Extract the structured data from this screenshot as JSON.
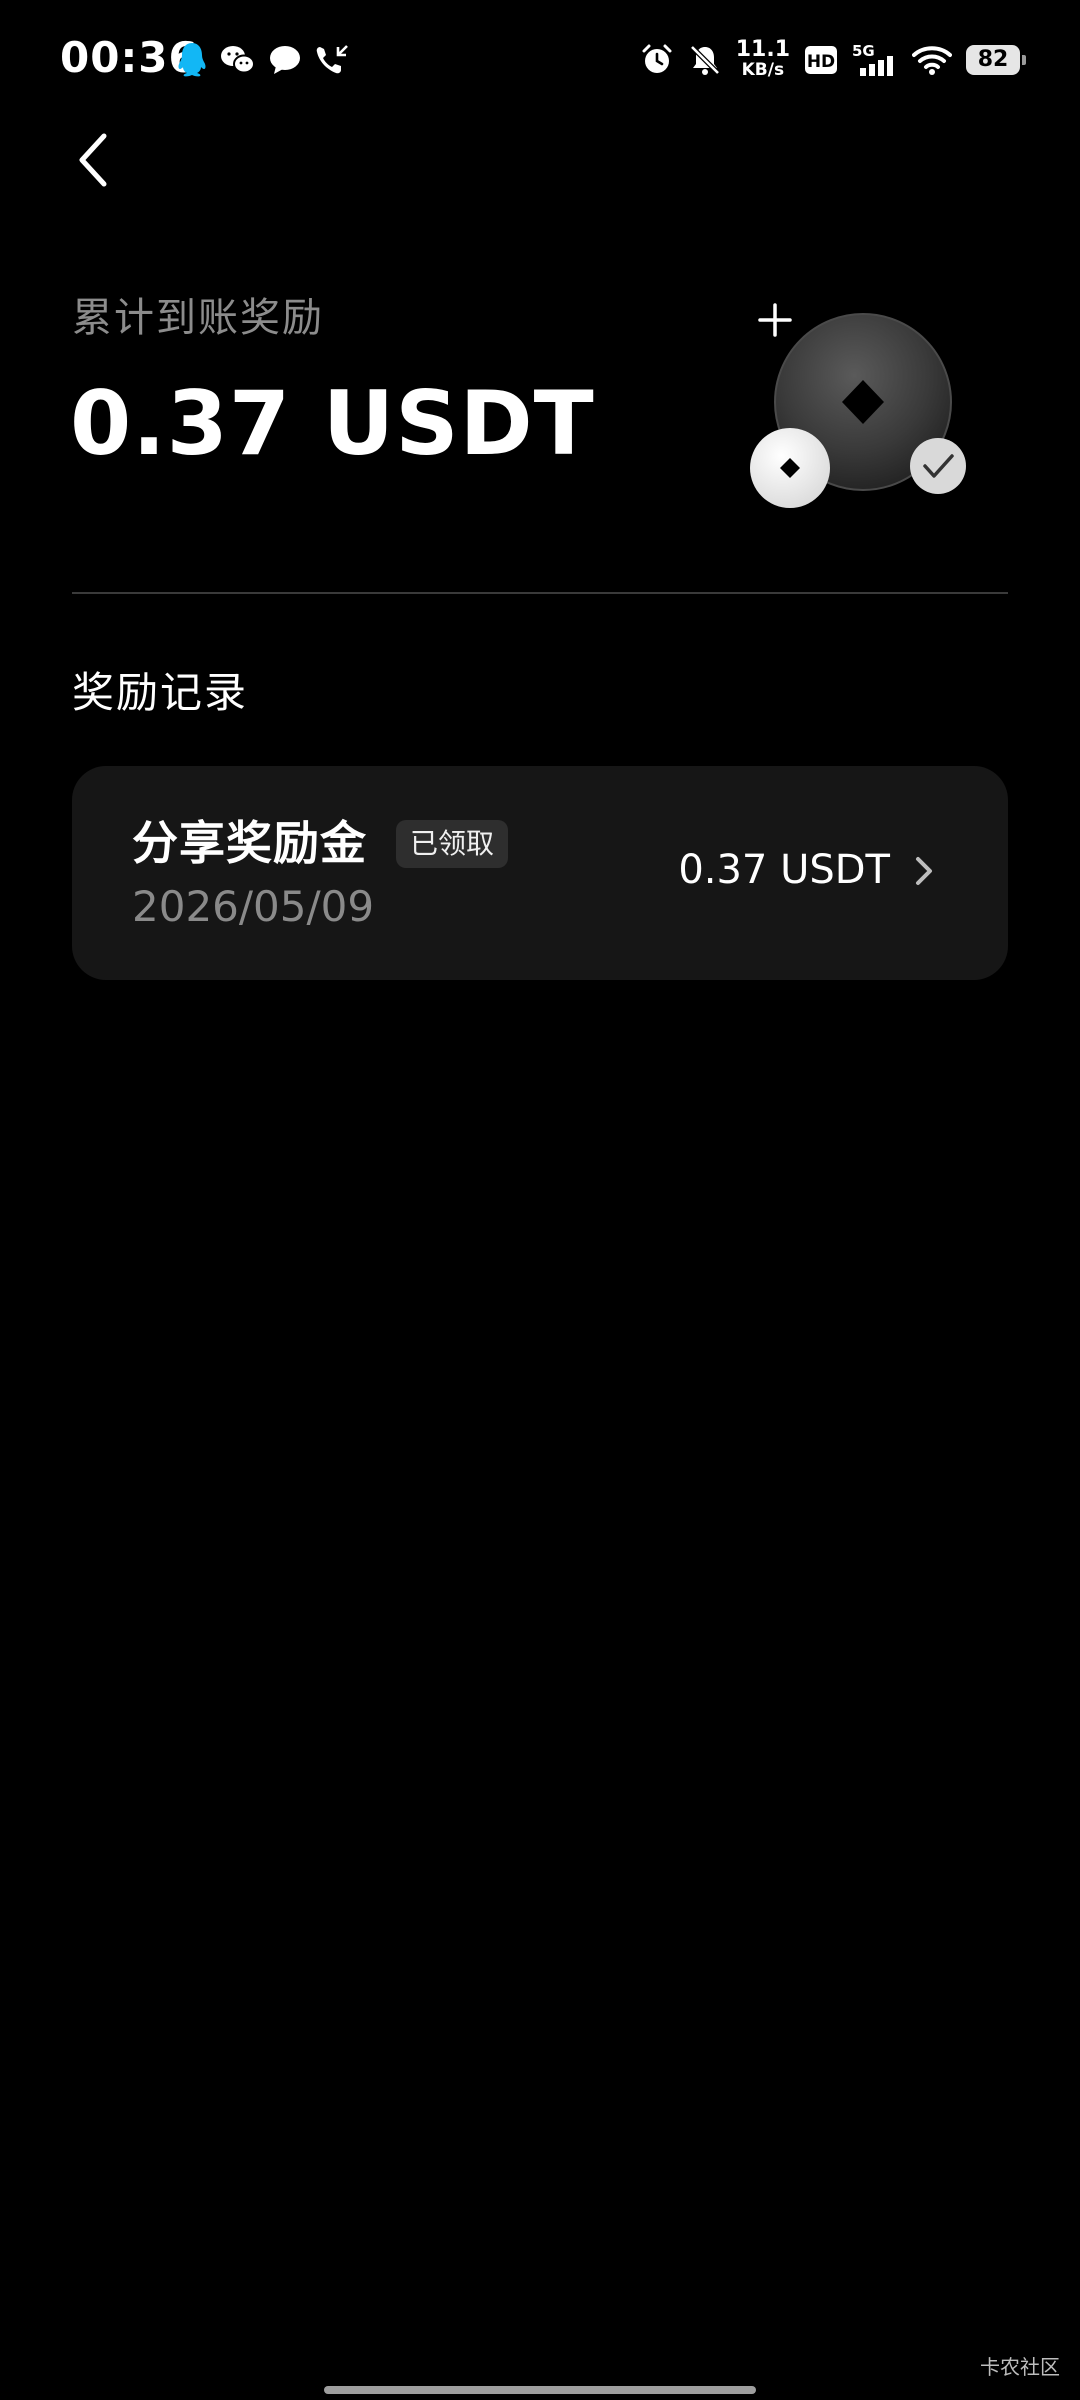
{
  "status_bar": {
    "time": "00:36",
    "app_icons": [
      "qq-icon",
      "wechat-icon",
      "message-icon",
      "missed-call-icon"
    ],
    "system_icons": [
      "alarm-icon",
      "mute-icon",
      "hd-icon",
      "signal-icon",
      "wifi-icon"
    ],
    "net_speed": "11.1",
    "net_speed_unit": "KB/s",
    "network_type": "5G",
    "hd_label": "HD",
    "battery": "82"
  },
  "header": {
    "back_icon": "chevron-left-icon",
    "summary_label": "累计到账奖励",
    "summary_amount": "0.37 USDT",
    "illustration": "coin-illustration"
  },
  "records": {
    "section_title": "奖励记录",
    "items": [
      {
        "title": "分享奖励金",
        "badge": "已领取",
        "date": "2026/05/09",
        "amount": "0.37 USDT"
      }
    ]
  },
  "watermark": "卡农社区",
  "colors": {
    "background": "#000000",
    "card": "#161616",
    "muted_text": "#8c8c8c",
    "badge_bg": "#2e2e2e",
    "qq_blue": "#12b7f5"
  }
}
